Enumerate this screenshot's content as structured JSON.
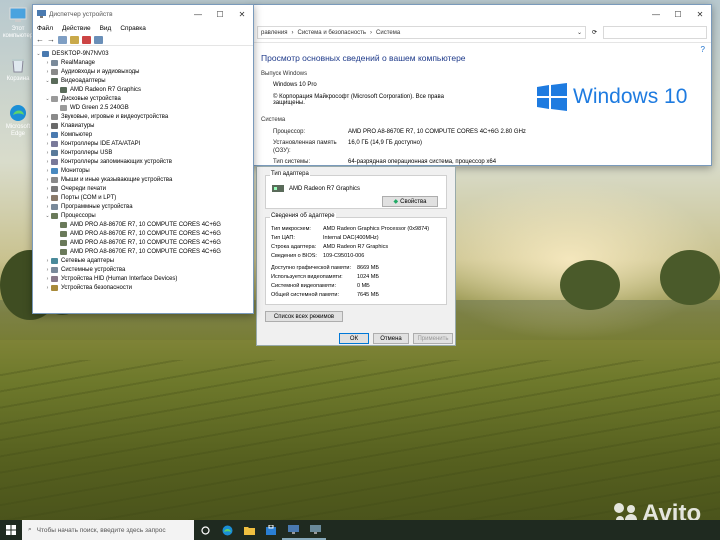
{
  "desktop": {
    "icons": [
      {
        "label": "Этот компьютер",
        "icon": "computer-icon"
      },
      {
        "label": "Корзина",
        "icon": "recycle-bin-icon"
      },
      {
        "label": "Microsoft Edge",
        "icon": "edge-icon"
      }
    ]
  },
  "devmgr": {
    "title": "Диспетчер устройств",
    "menu": [
      "Файл",
      "Действие",
      "Вид",
      "Справка"
    ],
    "tree": [
      {
        "label": "DESKTOP-9N7NV03",
        "level": 0,
        "expander": "v",
        "icon": "computer-icon"
      },
      {
        "label": "RealManage",
        "level": 1,
        "expander": ">",
        "icon": "device-icon"
      },
      {
        "label": "Аудиовходы и аудиовыходы",
        "level": 1,
        "expander": ">",
        "icon": "audio-icon"
      },
      {
        "label": "Видеоадаптеры",
        "level": 1,
        "expander": "v",
        "icon": "display-adapter-icon"
      },
      {
        "label": "AMD Radeon R7 Graphics",
        "level": 2,
        "expander": "",
        "icon": "display-adapter-icon"
      },
      {
        "label": "Дисковые устройства",
        "level": 1,
        "expander": "v",
        "icon": "disk-icon"
      },
      {
        "label": "WD Green 2.5 240GB",
        "level": 2,
        "expander": "",
        "icon": "disk-icon"
      },
      {
        "label": "Звуковые, игровые и видеоустройства",
        "level": 1,
        "expander": ">",
        "icon": "audio-icon"
      },
      {
        "label": "Клавиатуры",
        "level": 1,
        "expander": ">",
        "icon": "keyboard-icon"
      },
      {
        "label": "Компьютер",
        "level": 1,
        "expander": ">",
        "icon": "computer-icon"
      },
      {
        "label": "Контроллеры IDE ATA/ATAPI",
        "level": 1,
        "expander": ">",
        "icon": "controller-icon"
      },
      {
        "label": "Контроллеры USB",
        "level": 1,
        "expander": ">",
        "icon": "usb-icon"
      },
      {
        "label": "Контроллеры запоминающих устройств",
        "level": 1,
        "expander": ">",
        "icon": "controller-icon"
      },
      {
        "label": "Мониторы",
        "level": 1,
        "expander": ">",
        "icon": "monitor-icon"
      },
      {
        "label": "Мыши и иные указывающие устройства",
        "level": 1,
        "expander": ">",
        "icon": "mouse-icon"
      },
      {
        "label": "Очереди печати",
        "level": 1,
        "expander": ">",
        "icon": "printer-icon"
      },
      {
        "label": "Порты (COM и LPT)",
        "level": 1,
        "expander": ">",
        "icon": "port-icon"
      },
      {
        "label": "Программные устройства",
        "level": 1,
        "expander": ">",
        "icon": "device-icon"
      },
      {
        "label": "Процессоры",
        "level": 1,
        "expander": "v",
        "icon": "processor-icon"
      },
      {
        "label": "AMD PRO A8-8670E R7, 10 COMPUTE CORES 4C+6G",
        "level": 2,
        "expander": "",
        "icon": "processor-icon"
      },
      {
        "label": "AMD PRO A8-8670E R7, 10 COMPUTE CORES 4C+6G",
        "level": 2,
        "expander": "",
        "icon": "processor-icon"
      },
      {
        "label": "AMD PRO A8-8670E R7, 10 COMPUTE CORES 4C+6G",
        "level": 2,
        "expander": "",
        "icon": "processor-icon"
      },
      {
        "label": "AMD PRO A8-8670E R7, 10 COMPUTE CORES 4C+6G",
        "level": 2,
        "expander": "",
        "icon": "processor-icon"
      },
      {
        "label": "Сетевые адаптеры",
        "level": 1,
        "expander": ">",
        "icon": "network-icon"
      },
      {
        "label": "Системные устройства",
        "level": 1,
        "expander": ">",
        "icon": "device-icon"
      },
      {
        "label": "Устройства HID (Human Interface Devices)",
        "level": 1,
        "expander": ">",
        "icon": "hid-icon"
      },
      {
        "label": "Устройства безопасности",
        "level": 1,
        "expander": ">",
        "icon": "security-icon"
      }
    ]
  },
  "system": {
    "breadcrumb": [
      "равления",
      "Система и безопасность",
      "Система"
    ],
    "heading": "Просмотр основных сведений о вашем компьютере",
    "edition_label": "Выпуск Windows",
    "edition": "Windows 10 Pro",
    "copyright": "© Корпорация Майкрософт (Microsoft Corporation). Все права защищены.",
    "logo_text": "Windows 10",
    "system_label": "Система",
    "rows": [
      {
        "k": "Процессор:",
        "v": "AMD PRO A8-8670E R7, 10 COMPUTE CORES 4C+6G      2.80 GHz"
      },
      {
        "k": "Установленная память (ОЗУ):",
        "v": "16,0 ГБ (14,9 ГБ доступно)"
      },
      {
        "k": "Тип системы:",
        "v": "64-разрядная операционная система, процессор x64"
      }
    ]
  },
  "adapter": {
    "type_label": "Тип адаптера",
    "adapter_name": "AMD Radeon R7 Graphics",
    "properties_button": "Свойства",
    "info_label": "Сведения об адаптере",
    "info": [
      {
        "k": "Тип микросхем:",
        "v": "AMD Radeon Graphics Processor (0x9874)"
      },
      {
        "k": "Тип ЦАП:",
        "v": "Internal DAC(400MHz)"
      },
      {
        "k": "Строка адаптера:",
        "v": "AMD Radeon R7 Graphics"
      },
      {
        "k": "Сведения о BIOS:",
        "v": "109-C95010-006"
      }
    ],
    "memory": [
      {
        "k": "Доступно графической памяти:",
        "v": "8669 МБ"
      },
      {
        "k": "Используется видеопамяти:",
        "v": "1024 МБ"
      },
      {
        "k": "Системной видеопамяти:",
        "v": "0 МБ"
      },
      {
        "k": "Общей системной памяти:",
        "v": "7645 МБ"
      }
    ],
    "modes_button": "Список всех режимов",
    "ok": "ОК",
    "cancel": "Отмена",
    "apply": "Применить"
  },
  "taskbar": {
    "search_placeholder": "Чтобы начать поиск, введите здесь запрос"
  },
  "watermark": "Avito"
}
